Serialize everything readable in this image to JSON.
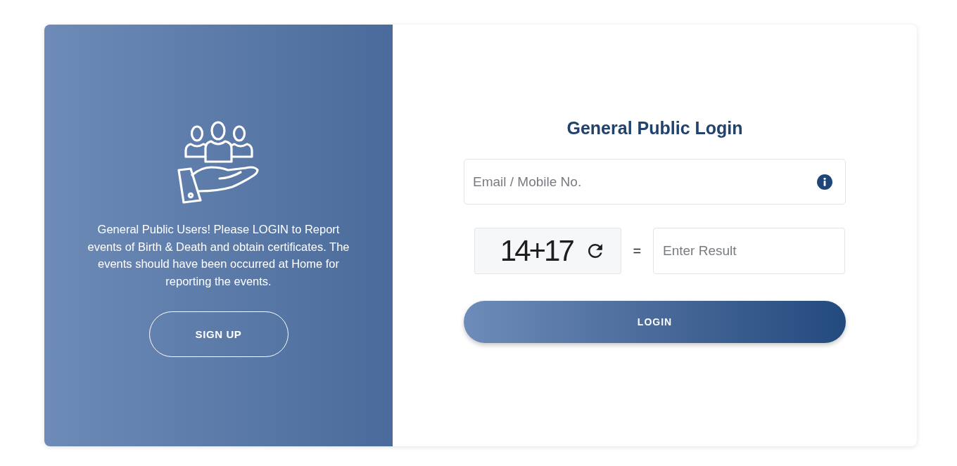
{
  "promo": {
    "message": "General Public Users! Please LOGIN to Report events of Birth & Death and obtain certificates. The events should have been occurred at Home for reporting the events.",
    "button": "SIGN UP"
  },
  "login": {
    "title": "General Public Login",
    "email": {
      "placeholder": "Email / Mobile No."
    },
    "captcha": {
      "question": "14+17",
      "operator": "="
    },
    "result": {
      "placeholder": "Enter Result"
    },
    "button": "LOGIN"
  }
}
